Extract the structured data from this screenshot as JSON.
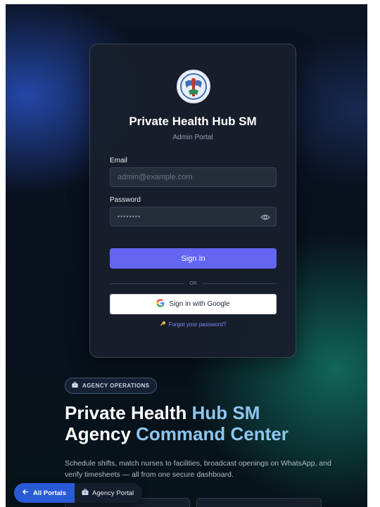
{
  "login": {
    "title": "Private Health Hub SM",
    "subtitle": "Admin Portal",
    "email_label": "Email",
    "email_placeholder": "admin@example.com",
    "password_label": "Password",
    "password_value": "••••••••",
    "signin_label": "Sign In",
    "divider_text": "OR",
    "google_label": "Sign in with Google",
    "forgot_label": "Forgot your password?"
  },
  "hero": {
    "badge": "AGENCY OPERATIONS",
    "title_line1_a": "Private Health ",
    "title_line1_b": "Hub SM",
    "title_line2_a": "Agency ",
    "title_line2_b": "Command Center",
    "description": "Schedule shifts, match nurses to facilities, broadcast openings on WhatsApp, and verify timesheets — all from one secure dashboard."
  },
  "bottom_nav": {
    "all_portals": "All Portals",
    "agency_portal": "Agency Portal"
  },
  "icons": {
    "logo": "medical-emblem-icon",
    "eye": "eye-icon",
    "google": "google-icon",
    "key": "key-icon",
    "briefcase": "briefcase-icon",
    "back_arrow": "arrow-left-icon"
  },
  "colors": {
    "primary": "#6366f1",
    "accent_blue": "#2a5bd7",
    "link": "#818cf8",
    "hero_highlight": "#8fc6ee"
  }
}
